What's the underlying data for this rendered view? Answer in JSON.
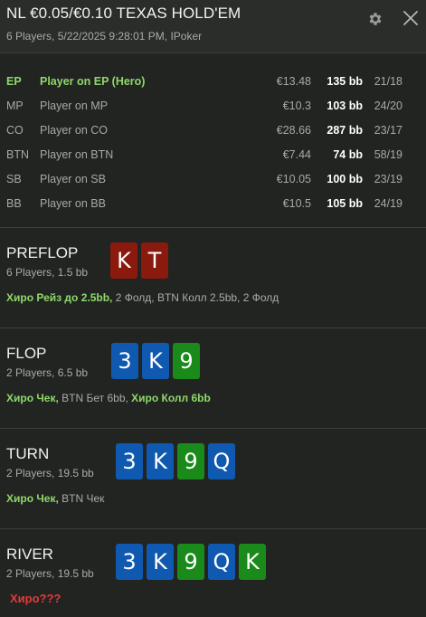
{
  "header": {
    "title": "NL €0.05/€0.10 TEXAS HOLD'EM",
    "subtitle": "6 Players, 5/22/2025 9:28:01 PM, IPoker",
    "settings_icon": "gear-icon",
    "close_icon": "close-icon"
  },
  "players": [
    {
      "pos": "EP",
      "name": "Player on EP (Hero)",
      "stack": "€13.48",
      "bb": "135 bb",
      "stats": "21/18",
      "hero": true
    },
    {
      "pos": "MP",
      "name": "Player on MP",
      "stack": "€10.3",
      "bb": "103 bb",
      "stats": "24/20"
    },
    {
      "pos": "CO",
      "name": "Player on CO",
      "stack": "€28.66",
      "bb": "287 bb",
      "stats": "23/17"
    },
    {
      "pos": "BTN",
      "name": "Player on BTN",
      "stack": "€7.44",
      "bb": "74 bb",
      "stats": "58/19"
    },
    {
      "pos": "SB",
      "name": "Player on SB",
      "stack": "€10.05",
      "bb": "100 bb",
      "stats": "23/19"
    },
    {
      "pos": "BB",
      "name": "Player on BB",
      "stack": "€10.5",
      "bb": "105 bb",
      "stats": "24/19"
    }
  ],
  "streets": {
    "preflop": {
      "name": "PREFLOP",
      "info": "6 Players, 1.5 bb",
      "cards": [
        {
          "rank": "K",
          "color": "#8b1a0e"
        },
        {
          "rank": "T",
          "color": "#8b1a0e"
        }
      ],
      "hero_action": "Хиро Рейз до 2.5bb,",
      "other_action": " 2 Фолд, BTN Колл 2.5bb, 2 Фолд"
    },
    "flop": {
      "name": "FLOP",
      "info": "2 Players, 6.5 bb",
      "cards": [
        {
          "rank": "3",
          "color": "#1059b0"
        },
        {
          "rank": "K",
          "color": "#1059b0"
        },
        {
          "rank": "9",
          "color": "#1a8a1a"
        }
      ],
      "hero_action_1": "Хиро Чек,",
      "other_action": " BTN Бет 6bb, ",
      "hero_action_2": "Хиро Колл 6bb"
    },
    "turn": {
      "name": "TURN",
      "info": "2 Players, 19.5 bb",
      "cards": [
        {
          "rank": "3",
          "color": "#1059b0"
        },
        {
          "rank": "K",
          "color": "#1059b0"
        },
        {
          "rank": "9",
          "color": "#1a8a1a"
        },
        {
          "rank": "Q",
          "color": "#1059b0"
        }
      ],
      "hero_action": "Хиро Чек,",
      "other_action": " BTN Чек"
    },
    "river": {
      "name": "RIVER",
      "info": "2 Players, 19.5 bb",
      "cards": [
        {
          "rank": "3",
          "color": "#1059b0"
        },
        {
          "rank": "K",
          "color": "#1059b0"
        },
        {
          "rank": "9",
          "color": "#1a8a1a"
        },
        {
          "rank": "Q",
          "color": "#1059b0"
        },
        {
          "rank": "K",
          "color": "#1a8a1a"
        }
      ],
      "hero_action": "Хиро???"
    }
  }
}
